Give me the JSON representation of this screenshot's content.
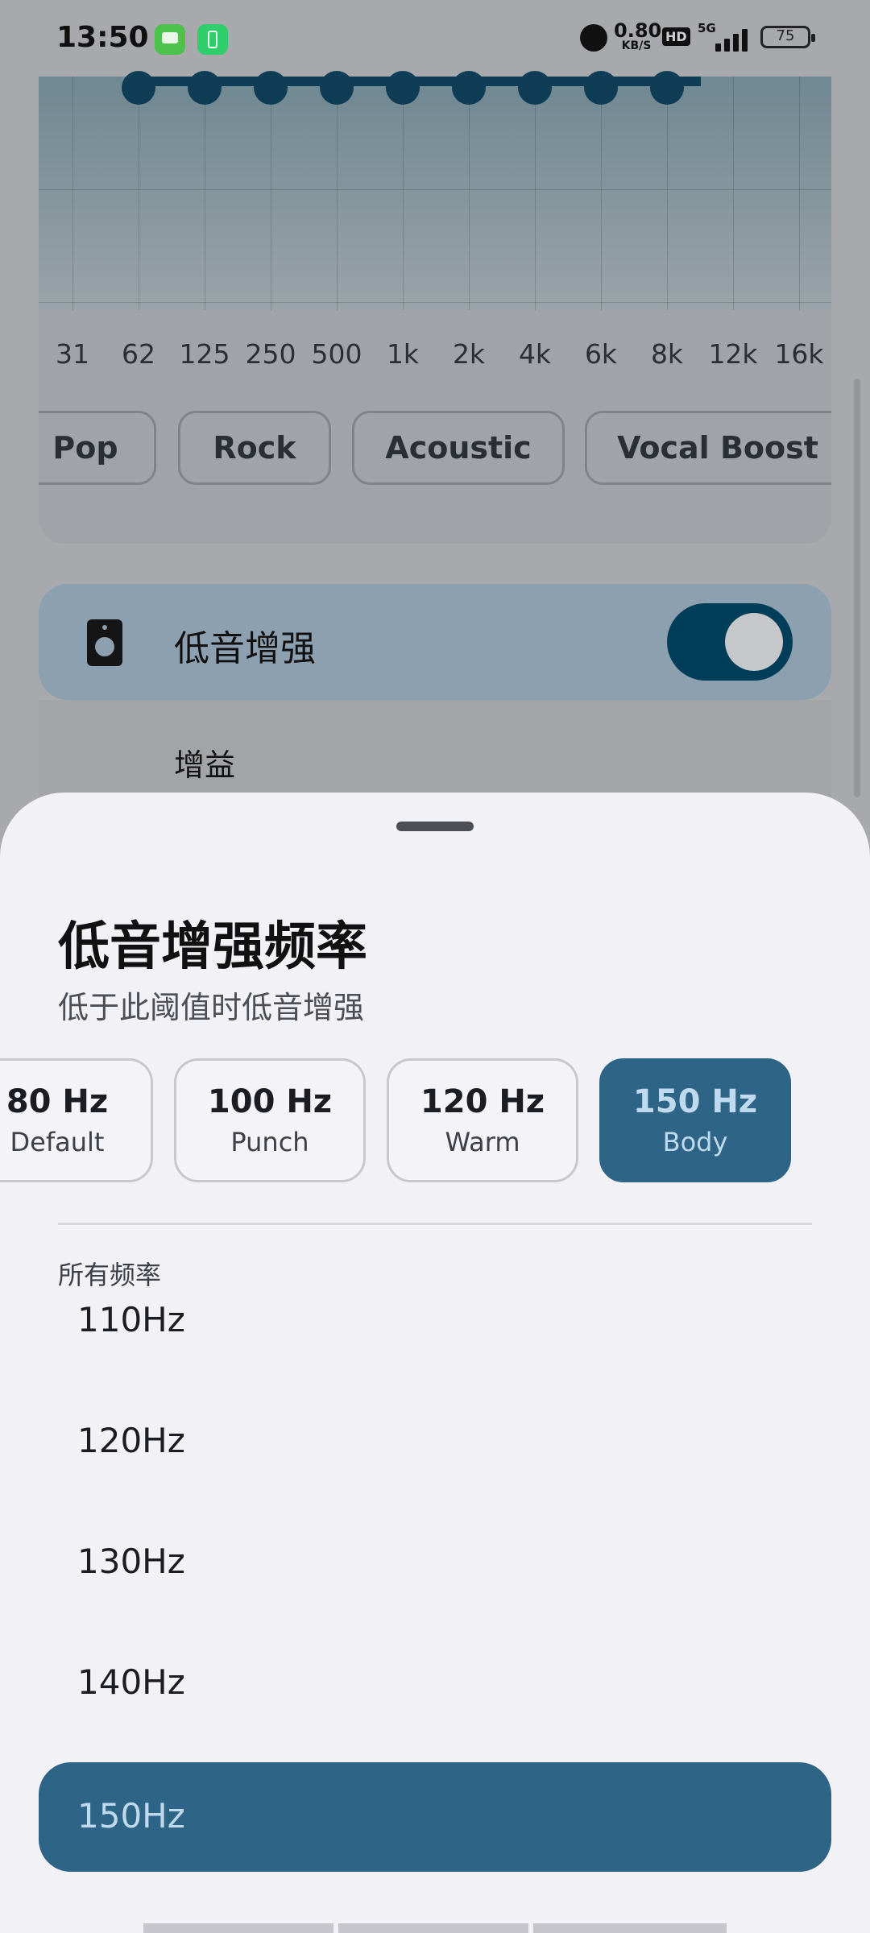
{
  "status_bar": {
    "time": "13:50",
    "net_speed": "0.80",
    "net_unit": "KB/S",
    "hd_badge": "HD",
    "network_type": "5G",
    "battery": "75",
    "icons": [
      "chat-app-icon",
      "battery-saver-app-icon",
      "alarm-icon",
      "signal-icon",
      "battery-icon"
    ]
  },
  "equalizer": {
    "frequency_labels": [
      "31",
      "62",
      "125",
      "250",
      "500",
      "1k",
      "2k",
      "4k",
      "6k",
      "8k",
      "12k",
      "16k"
    ],
    "presets": [
      "Pop",
      "Rock",
      "Acoustic",
      "Vocal Boost"
    ]
  },
  "bass_boost": {
    "label": "低音增强",
    "enabled": true,
    "gain_label": "增益"
  },
  "sheet": {
    "title": "低音增强频率",
    "subtitle": "低于此阈值时低音增强",
    "quick_options": [
      {
        "hz": "80 Hz",
        "tag": "Default"
      },
      {
        "hz": "100 Hz",
        "tag": "Punch"
      },
      {
        "hz": "120 Hz",
        "tag": "Warm"
      },
      {
        "hz": "150 Hz",
        "tag": "Body",
        "selected": true
      }
    ],
    "section_label": "所有频率",
    "frequencies": [
      "110Hz",
      "120Hz",
      "130Hz",
      "140Hz",
      "150Hz"
    ],
    "selected_frequency": "150Hz"
  },
  "colors": {
    "accent": "#2e6486",
    "accent_text": "#bfd9ef",
    "toggle_on": "#003d58",
    "sheet_bg": "#f2f1f6"
  }
}
